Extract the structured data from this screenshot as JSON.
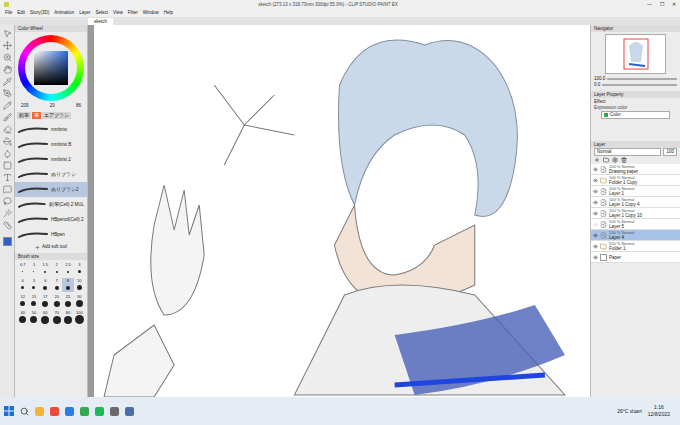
{
  "window": {
    "title": "sketch (273.13 x 318.73mm 300dpi 55.0%) - CLIP STUDIO PAINT EX",
    "controls": [
      "—",
      "☐",
      "✕"
    ]
  },
  "menu": [
    "File",
    "Edit",
    "Story(3D)",
    "Animation",
    "Layer",
    "Select",
    "View",
    "Filter",
    "Window",
    "Help"
  ],
  "doc_tabs": [
    {
      "label": "sketch",
      "selected": true
    }
  ],
  "color_panel": {
    "title": "Color Wheel",
    "values": [
      "209",
      "20",
      "86"
    ]
  },
  "subtool_group_tabs": [
    {
      "label": "鉛筆",
      "selected": false
    },
    {
      "label": "筆",
      "selected": true
    },
    {
      "label": "エアブラシ",
      "selected": false
    }
  ],
  "subtools": [
    {
      "name": "mmbrist",
      "selected": false
    },
    {
      "name": "mmbrist B",
      "selected": false
    },
    {
      "name": "mmbrist 2",
      "selected": false
    },
    {
      "name": "ぬりブラシ",
      "selected": false
    },
    {
      "name": "ぬりブラシ2",
      "selected": true
    },
    {
      "name": "鉛筆(Cell) 2 MUL",
      "selected": false
    },
    {
      "name": "HBpencil(Cell) 2",
      "selected": false
    },
    {
      "name": "HBpen",
      "selected": false
    }
  ],
  "add_subtool": "Add sub tool",
  "brush_size": {
    "title": "Brush size",
    "sizes": [
      {
        "label": "0.7",
        "selected": false
      },
      {
        "label": "1",
        "selected": false
      },
      {
        "label": "1.5",
        "selected": false
      },
      {
        "label": "2",
        "selected": false
      },
      {
        "label": "2.5",
        "selected": false
      },
      {
        "label": "3",
        "selected": false
      },
      {
        "label": "4",
        "selected": false
      },
      {
        "label": "5",
        "selected": false
      },
      {
        "label": "6",
        "selected": false
      },
      {
        "label": "7",
        "selected": false
      },
      {
        "label": "8",
        "selected": true
      },
      {
        "label": "10",
        "selected": false
      },
      {
        "label": "12",
        "selected": false
      },
      {
        "label": "15",
        "selected": false
      },
      {
        "label": "17",
        "selected": false
      },
      {
        "label": "20",
        "selected": false
      },
      {
        "label": "25",
        "selected": false
      },
      {
        "label": "30",
        "selected": false
      },
      {
        "label": "40",
        "selected": false
      },
      {
        "label": "50",
        "selected": false
      },
      {
        "label": "60",
        "selected": false
      },
      {
        "label": "70",
        "selected": false
      },
      {
        "label": "80",
        "selected": false
      },
      {
        "label": "100",
        "selected": false
      }
    ]
  },
  "navigator": {
    "title": "Navigator",
    "zoom": "100.0",
    "angle": "0.0"
  },
  "layer_property": {
    "title": "Layer Property",
    "effect": "Effect",
    "expression_label": "Expression color",
    "expression_value": "Color"
  },
  "layers": {
    "title": "Layer",
    "blend": "Normal",
    "opacity": "100",
    "rows": [
      {
        "mode": "100 % Normal",
        "name": "Drawing paper",
        "kind": "layer",
        "visible": true,
        "selected": false
      },
      {
        "mode": "100 % Normal",
        "name": "Folder 1 Copy",
        "kind": "folder",
        "visible": true,
        "selected": false
      },
      {
        "mode": "100 % Normal",
        "name": "Layer 1",
        "kind": "layer",
        "visible": true,
        "selected": false
      },
      {
        "mode": "100 % Normal",
        "name": "Layer 1 Copy 4",
        "kind": "layer",
        "visible": true,
        "selected": false
      },
      {
        "mode": "100 % Normal",
        "name": "Layer 1 Copy 10",
        "kind": "layer",
        "visible": true,
        "selected": false
      },
      {
        "mode": "100 % Normal",
        "name": "Layer 5",
        "kind": "layer",
        "visible": false,
        "selected": false
      },
      {
        "mode": "100 % Normal",
        "name": "Layer 4",
        "kind": "layer",
        "visible": true,
        "selected": true
      },
      {
        "mode": "100 % Normal",
        "name": "Folder 1",
        "kind": "folder",
        "visible": true,
        "selected": false
      },
      {
        "mode": "",
        "name": "Paper",
        "kind": "paper",
        "visible": true,
        "selected": false
      }
    ]
  },
  "taskbar": {
    "weather": "26°C ฝนตก",
    "time": "1:16",
    "date": "12/8/2022"
  }
}
